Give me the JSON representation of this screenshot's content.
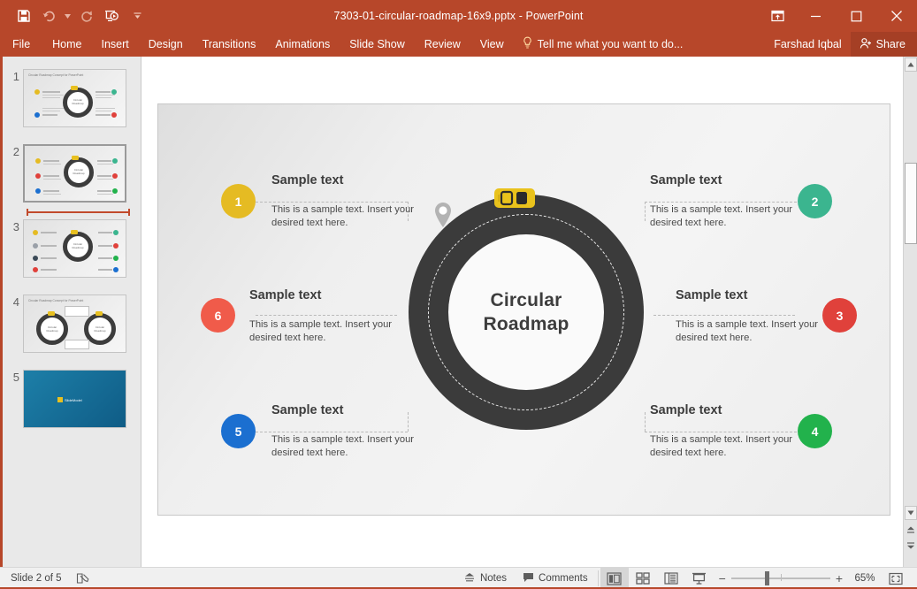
{
  "window": {
    "title": "7303-01-circular-roadmap-16x9.pptx - PowerPoint",
    "accent_color": "#b7472a",
    "quick_access": [
      {
        "name": "save",
        "icon": "save-icon"
      },
      {
        "name": "undo",
        "icon": "undo-icon"
      },
      {
        "name": "redo",
        "icon": "redo-icon"
      },
      {
        "name": "start-presentation",
        "icon": "presentation-icon"
      },
      {
        "name": "customize-qat",
        "icon": "chevron-down-icon"
      }
    ],
    "controls": {
      "ribbon_options": "ribbon-display-options-icon",
      "minimize": "minimize-icon",
      "maximize": "maximize-icon",
      "close": "close-icon"
    }
  },
  "ribbon": {
    "tabs": [
      "File",
      "Home",
      "Insert",
      "Design",
      "Transitions",
      "Animations",
      "Slide Show",
      "Review",
      "View"
    ],
    "tell_me": "Tell me what you want to do...",
    "user_name": "Farshad Iqbal",
    "share_label": "Share"
  },
  "thumbnails": {
    "selected_index": 2,
    "items": [
      {
        "number": "1",
        "has_title": true,
        "title": "Circular Roadmap Concept for PowerPoint",
        "rows": 2
      },
      {
        "number": "2",
        "has_title": false,
        "title": "",
        "rows": 3
      },
      {
        "number": "3",
        "has_title": false,
        "title": "",
        "rows": 4
      },
      {
        "number": "4",
        "has_title": true,
        "title": "Circular Roadmap Concept for PowerPoint",
        "rows": 0
      },
      {
        "number": "5",
        "has_title": false,
        "title": "SlideModel",
        "rows": 0
      }
    ]
  },
  "slide": {
    "center_line_1": "Circular",
    "center_line_2": "Roadmap",
    "road_color": "#3b3b3b",
    "car_color": "#e9c21c",
    "pin_color": "#b0b0b0",
    "items": [
      {
        "number": "1",
        "color": "#e5bb23",
        "heading": "Sample text",
        "body": "This is a sample text. Insert your desired text here.",
        "side": "left"
      },
      {
        "number": "2",
        "color": "#3bb58f",
        "heading": "Sample text",
        "body": "This is a sample text. Insert your desired text here.",
        "side": "right"
      },
      {
        "number": "3",
        "color": "#e0413b",
        "heading": "Sample text",
        "body": "This is a sample text. Insert your desired text here.",
        "side": "right"
      },
      {
        "number": "4",
        "color": "#22b24c",
        "heading": "Sample text",
        "body": "This is a sample text. Insert your desired text here.",
        "side": "right"
      },
      {
        "number": "5",
        "color": "#1b6fd0",
        "heading": "Sample text",
        "body": "This is a sample text. Insert your desired text here.",
        "side": "left"
      },
      {
        "number": "6",
        "color": "#f05b4a",
        "heading": "Sample text",
        "body": "This is a sample text. Insert your desired text here.",
        "side": "left"
      }
    ]
  },
  "status_bar": {
    "slide_position": "Slide 2 of 5",
    "notes_label": "Notes",
    "comments_label": "Comments",
    "zoom_level": "65%",
    "views": [
      {
        "name": "normal-view",
        "active": true
      },
      {
        "name": "slide-sorter-view",
        "active": false
      },
      {
        "name": "reading-view",
        "active": false
      },
      {
        "name": "slide-show-view",
        "active": false
      }
    ],
    "zoom_out_label": "−",
    "zoom_in_label": "+"
  }
}
